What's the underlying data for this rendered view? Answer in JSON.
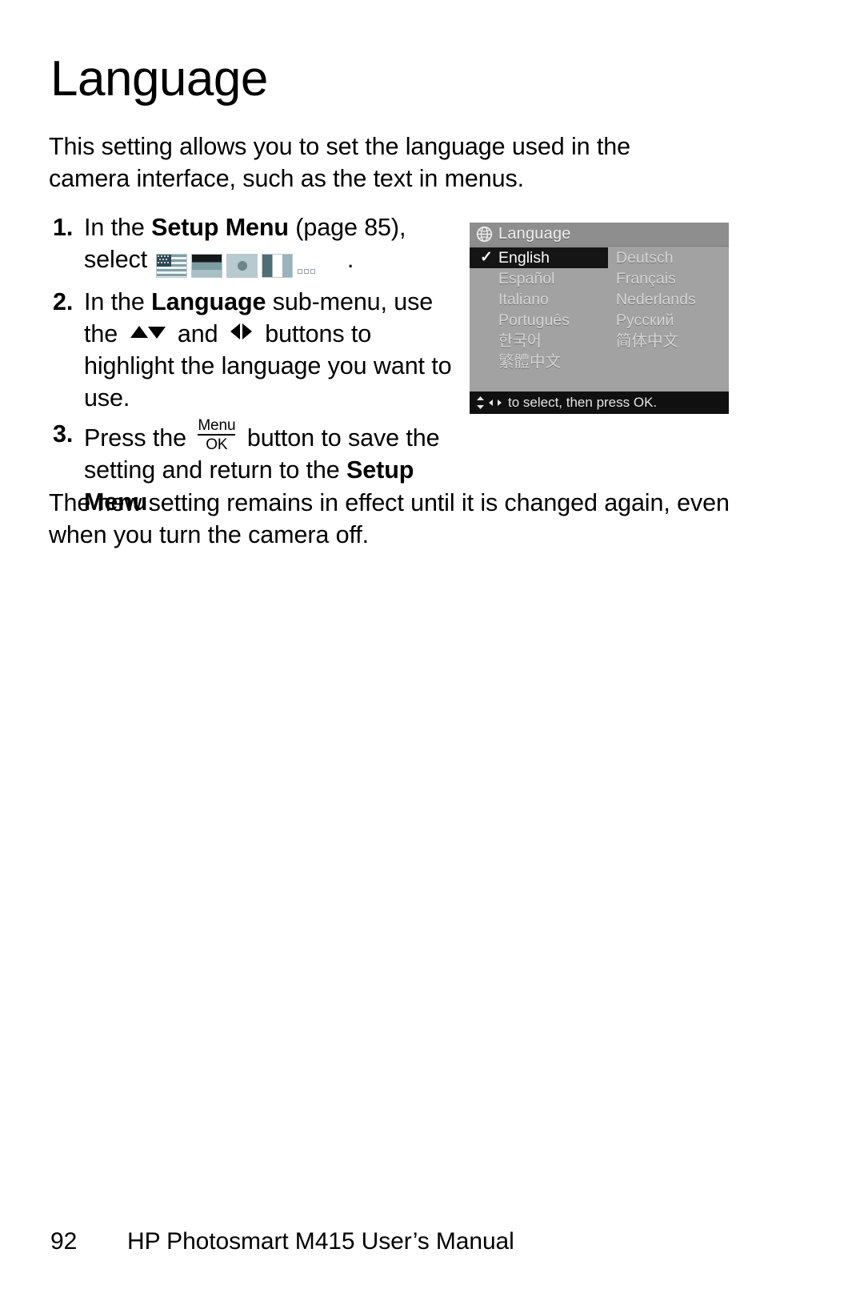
{
  "document": {
    "title": "Language",
    "intro": "This setting allows you to set the language used in the camera interface, such as the text in menus.",
    "closing": "The new setting remains in effect until it is changed again, even when you turn the camera off."
  },
  "steps": [
    {
      "number": "1.",
      "text_before": "In the ",
      "bold_1": "Setup Menu",
      "text_mid": " (page 85), select",
      "text_after": ".",
      "icons": [
        "us-flag-icon",
        "german-flag-icon",
        "japanese-flag-icon",
        "french-flag-icon",
        "ellipsis-squares-icon"
      ]
    },
    {
      "number": "2.",
      "text_before": "In the ",
      "bold_1": "Language",
      "text_mid": " sub-menu, use the ",
      "icon_1": "up-down-arrows-icon",
      "text_mid2": " and ",
      "icon_2": "left-right-arrows-icon",
      "text_after": " buttons to highlight the language you want to use."
    },
    {
      "number": "3.",
      "text_before": "Press the ",
      "icon_1": "menu-ok-button-icon",
      "menu_label_top": "Menu",
      "menu_label_bottom": "OK",
      "text_mid": " button to save the setting and return to the ",
      "bold_1": "Setup Menu",
      "text_after": "."
    }
  ],
  "lcd_screen": {
    "titlebar": {
      "icon": "globe-icon",
      "title": "Language"
    },
    "columns": {
      "left": [
        {
          "label": "English",
          "selected": true,
          "check": "✓"
        },
        {
          "label": "Español",
          "selected": false
        },
        {
          "label": "Italiano",
          "selected": false
        },
        {
          "label": "Português",
          "selected": false
        },
        {
          "label": "한국어",
          "selected": false
        },
        {
          "label": "繁體中文",
          "selected": false
        }
      ],
      "right": [
        {
          "label": "Deutsch",
          "selected": false
        },
        {
          "label": "Français",
          "selected": false
        },
        {
          "label": "Nederlands",
          "selected": false
        },
        {
          "label": "Русский",
          "selected": false
        },
        {
          "label": "简体中文",
          "selected": false
        },
        {
          "label": "",
          "selected": false
        }
      ]
    },
    "footer_hint": "to select, then press OK.",
    "colors": {
      "background": "#a3a3a3",
      "titlebar": "#8e8e8e",
      "selected_row": "#121212",
      "footer_bar": "#0d0d0d",
      "text": "#d6d6d6"
    }
  },
  "page_footer": {
    "page_number": "92",
    "manual_title": "HP Photosmart M415 User’s Manual"
  }
}
